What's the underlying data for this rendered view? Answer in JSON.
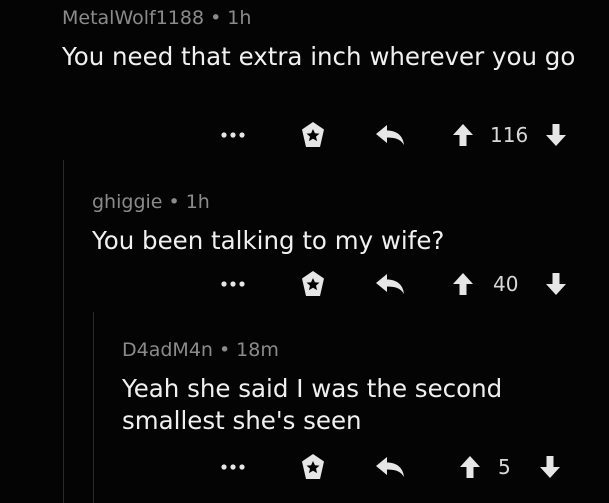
{
  "comments": [
    {
      "author": "MetalWolf1188",
      "separator": "•",
      "time": "1h",
      "text": "You need that extra inch wherever you go",
      "more_label": "...",
      "score": "116"
    },
    {
      "author": "ghiggie",
      "separator": "•",
      "time": "1h",
      "text": "You been talking to my wife?",
      "more_label": "...",
      "score": "40"
    },
    {
      "author": "D4adM4n",
      "separator": "•",
      "time": "18m",
      "text": "Yeah she said I was the second smallest she's seen",
      "more_label": "...",
      "score": "5"
    }
  ],
  "icons": {
    "more": "more-options-icon",
    "award": "award-icon",
    "reply": "reply-icon",
    "upvote": "upvote-arrow-icon",
    "downvote": "downvote-arrow-icon"
  },
  "colors": {
    "background": "#040404",
    "metadata": "#8b8b8b",
    "text": "#f0f0f0",
    "icons": "#e6e6e6",
    "thread_line": "#2a2a2a"
  }
}
